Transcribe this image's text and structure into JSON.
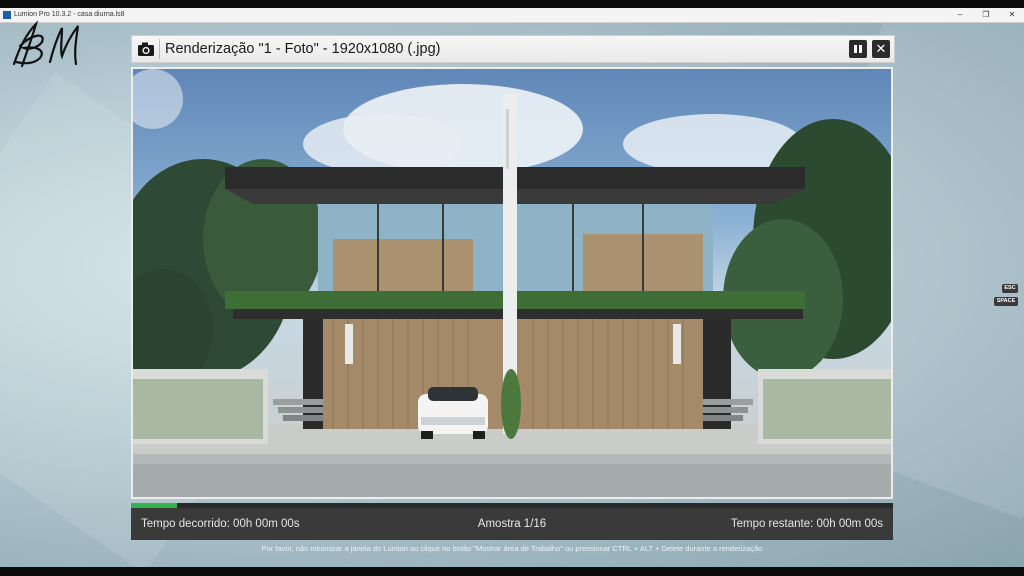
{
  "window": {
    "title": "Lumion Pro 10.3.2  -  casa diurna.ls8",
    "min_glyph": "–",
    "max_glyph": "❐",
    "close_glyph": "✕"
  },
  "dialog": {
    "title": "Renderização \"1 - Foto\" - 1920x1080 (.jpg)",
    "camera_icon": "camera-icon",
    "pause_icon": "pause-icon",
    "close_glyph": "✕"
  },
  "progress": {
    "fraction": 0.06
  },
  "status": {
    "elapsed": "Tempo decorrido: 00h 00m 00s",
    "sample": "Amostra 1/16",
    "remaining": "Tempo restante: 00h 00m 00s"
  },
  "footer_note": "Por favor, não minimizar a janela do Lumion ou clique no botão \"Mostrar área de Trabalho\" ou pressionar CTRL + ALT + Delete durante a renderização",
  "keys": {
    "esc": "ESC",
    "space": "SPACE"
  },
  "colors": {
    "progress": "#34b44a",
    "status_bg": "#3a3a3a",
    "header_btn": "#2b2b2b"
  }
}
